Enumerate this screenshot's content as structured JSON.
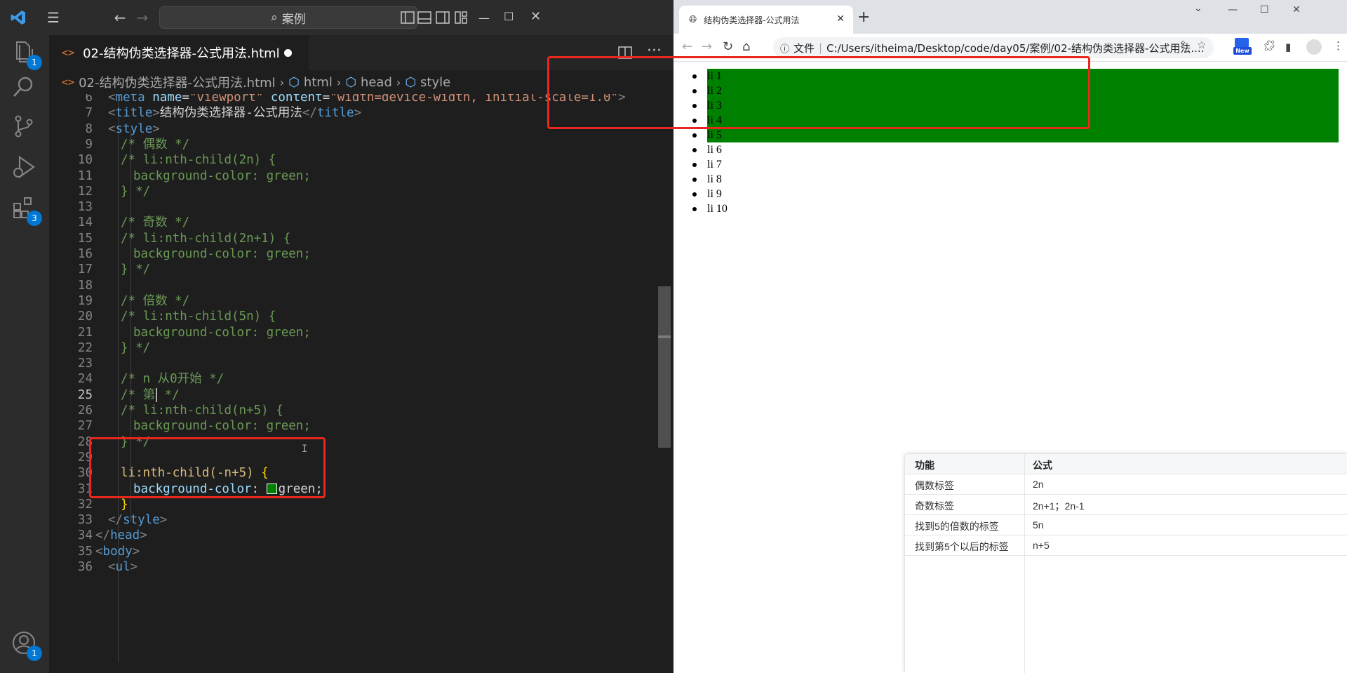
{
  "vscode": {
    "search_text": "案例",
    "tab": {
      "filename": "02-结构伪类选择器-公式用法.html"
    },
    "breadcrumb": {
      "file": "02-结构伪类选择器-公式用法.html",
      "html": "html",
      "head": "head",
      "style": "style"
    },
    "badges": {
      "explorer": "1",
      "extensions": "3",
      "account": "1"
    },
    "code_lines": [
      {
        "n": "6",
        "text": "<meta name=\"viewport\" content=\"width=device-width, initial-scale=1.0\">"
      },
      {
        "n": "7",
        "text": "<title>结构伪类选择器-公式用法</title>"
      },
      {
        "n": "8",
        "text": "<style>"
      },
      {
        "n": "9",
        "text": "/* 偶数 */"
      },
      {
        "n": "10",
        "text": "/* li:nth-child(2n) {"
      },
      {
        "n": "11",
        "text": "background-color: green;"
      },
      {
        "n": "12",
        "text": "} */"
      },
      {
        "n": "13",
        "text": ""
      },
      {
        "n": "14",
        "text": "/* 奇数 */"
      },
      {
        "n": "15",
        "text": "/* li:nth-child(2n+1) {"
      },
      {
        "n": "16",
        "text": "background-color: green;"
      },
      {
        "n": "17",
        "text": "} */"
      },
      {
        "n": "18",
        "text": ""
      },
      {
        "n": "19",
        "text": "/* 倍数 */"
      },
      {
        "n": "20",
        "text": "/* li:nth-child(5n) {"
      },
      {
        "n": "21",
        "text": "background-color: green;"
      },
      {
        "n": "22",
        "text": "} */"
      },
      {
        "n": "23",
        "text": ""
      },
      {
        "n": "24",
        "text": "/* n 从0开始 */"
      },
      {
        "n": "25",
        "text": "/* 第 */"
      },
      {
        "n": "26",
        "text": "/* li:nth-child(n+5) {"
      },
      {
        "n": "27",
        "text": "background-color: green;"
      },
      {
        "n": "28",
        "text": "} */"
      },
      {
        "n": "29",
        "text": ""
      },
      {
        "n": "30",
        "text": "li:nth-child(-n+5) {"
      },
      {
        "n": "31",
        "text": "background-color: green;"
      },
      {
        "n": "32",
        "text": "}"
      },
      {
        "n": "33",
        "text": "</style>"
      },
      {
        "n": "34",
        "text": "</head>"
      },
      {
        "n": "35",
        "text": "<body>"
      },
      {
        "n": "36",
        "text": "<ul>"
      }
    ],
    "current_line": "25"
  },
  "browser": {
    "tab_title": "结构伪类选择器-公式用法",
    "address_label": "文件",
    "address": "C:/Users/itheima/Desktop/code/day05/案例/02-结构伪类选择器-公式用法....",
    "new_badge": "New",
    "list_items": [
      {
        "text": "li 1",
        "highlighted": true
      },
      {
        "text": "li 2",
        "highlighted": true
      },
      {
        "text": "li 3",
        "highlighted": true
      },
      {
        "text": "li 4",
        "highlighted": true
      },
      {
        "text": "li 5",
        "highlighted": true
      },
      {
        "text": "li 6",
        "highlighted": false
      },
      {
        "text": "li 7",
        "highlighted": false
      },
      {
        "text": "li 8",
        "highlighted": false
      },
      {
        "text": "li 9",
        "highlighted": false
      },
      {
        "text": "li 10",
        "highlighted": false
      }
    ],
    "highlight_color": "#008000"
  },
  "ref_table": {
    "headers": [
      "功能",
      "公式"
    ],
    "rows": [
      [
        "偶数标签",
        "2n"
      ],
      [
        "奇数标签",
        "2n+1；2n-1"
      ],
      [
        "找到5的倍数的标签",
        "5n"
      ],
      [
        "找到第5个以后的标签",
        "n+5"
      ]
    ]
  },
  "colors": {
    "annotation_red": "#e8281c",
    "vscode_bg": "#1e1e1e",
    "accent": "#0078d4"
  }
}
